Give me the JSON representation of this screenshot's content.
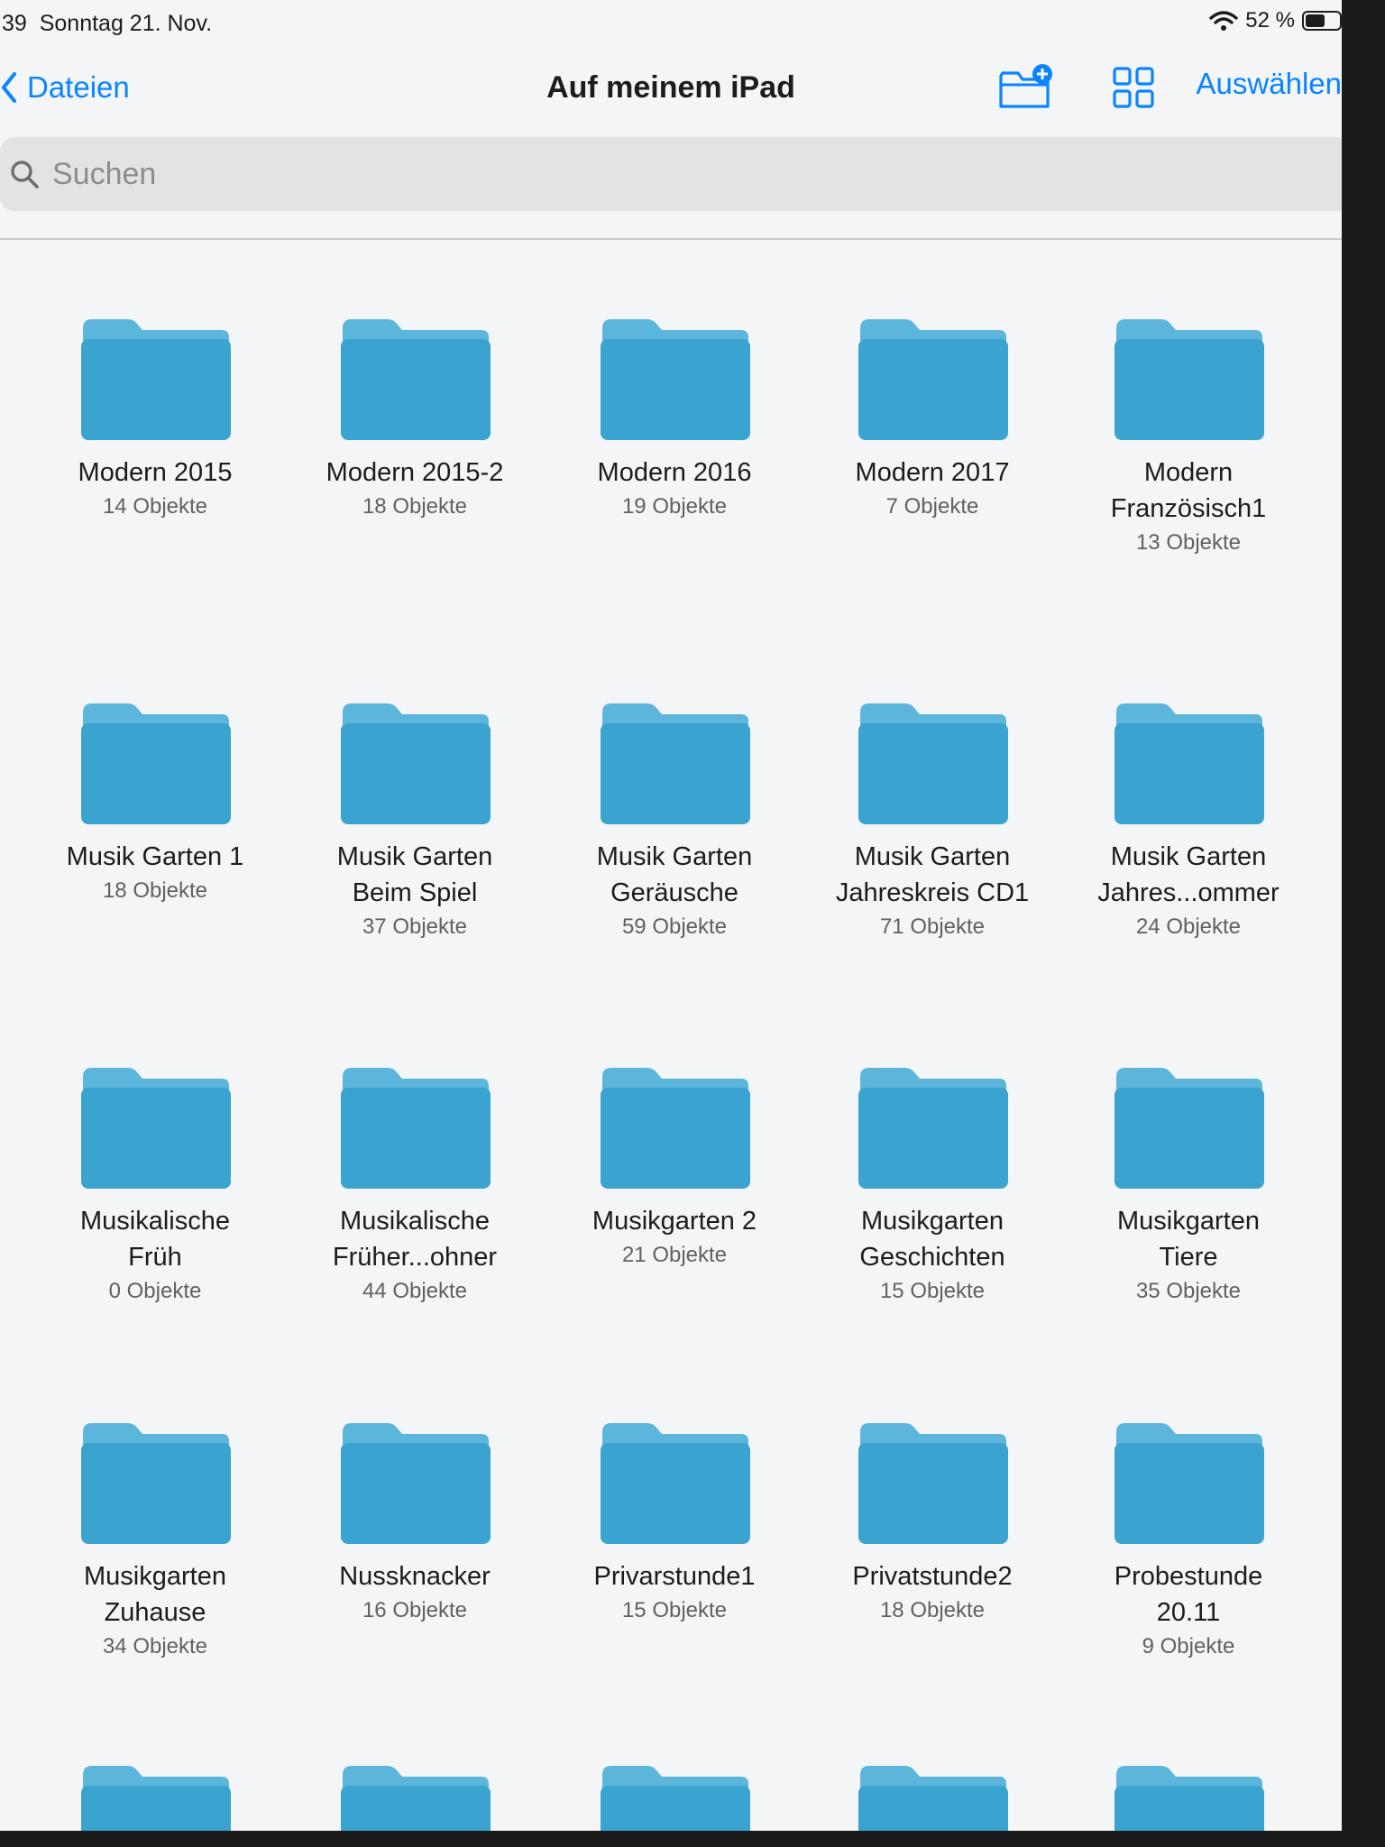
{
  "status_bar": {
    "time": "39",
    "date": "Sonntag 21. Nov.",
    "battery": "52 %"
  },
  "nav": {
    "back_label": "Dateien",
    "title": "Auf meinem iPad",
    "select_label": "Auswählen"
  },
  "search": {
    "placeholder": "Suchen"
  },
  "folders": [
    {
      "name": "Modern 2015",
      "count": "14 Objekte"
    },
    {
      "name": "Modern 2015-2",
      "count": "18 Objekte"
    },
    {
      "name": "Modern 2016",
      "count": "19 Objekte"
    },
    {
      "name": "Modern 2017",
      "count": "7 Objekte"
    },
    {
      "name": "Modern\nFranzösisch1",
      "count": "13 Objekte"
    },
    {
      "name": "Musik Garten 1",
      "count": "18 Objekte"
    },
    {
      "name": "Musik Garten\nBeim Spiel",
      "count": "37 Objekte"
    },
    {
      "name": "Musik Garten\nGeräusche",
      "count": "59 Objekte"
    },
    {
      "name": "Musik Garten\nJahreskreis CD1",
      "count": "71 Objekte"
    },
    {
      "name": "Musik Garten\nJahres...ommer",
      "count": "24 Objekte"
    },
    {
      "name": "Musikalische\nFrüh",
      "count": "0 Objekte"
    },
    {
      "name": "Musikalische\nFrüher...ohner",
      "count": "44 Objekte"
    },
    {
      "name": "Musikgarten 2",
      "count": "21 Objekte"
    },
    {
      "name": "Musikgarten\nGeschichten",
      "count": "15 Objekte"
    },
    {
      "name": "Musikgarten\nTiere",
      "count": "35 Objekte"
    },
    {
      "name": "Musikgarten\nZuhause",
      "count": "34 Objekte"
    },
    {
      "name": "Nussknacker",
      "count": "16 Objekte"
    },
    {
      "name": "Privarstunde1",
      "count": "15 Objekte"
    },
    {
      "name": "Privatstunde2",
      "count": "18 Objekte"
    },
    {
      "name": "Probestunde\n20.11",
      "count": "9 Objekte"
    },
    {
      "name": "",
      "count": ""
    },
    {
      "name": "",
      "count": ""
    },
    {
      "name": "",
      "count": ""
    },
    {
      "name": "",
      "count": ""
    },
    {
      "name": "",
      "count": ""
    }
  ],
  "colors": {
    "accent": "#0a84ff",
    "folder_body": "#3aa3cf",
    "folder_tab": "#5cb6dc"
  },
  "icons": [
    "wifi-icon",
    "battery-icon",
    "chevron-left-icon",
    "new-folder-icon",
    "grid-view-icon",
    "search-icon",
    "folder-icon"
  ]
}
